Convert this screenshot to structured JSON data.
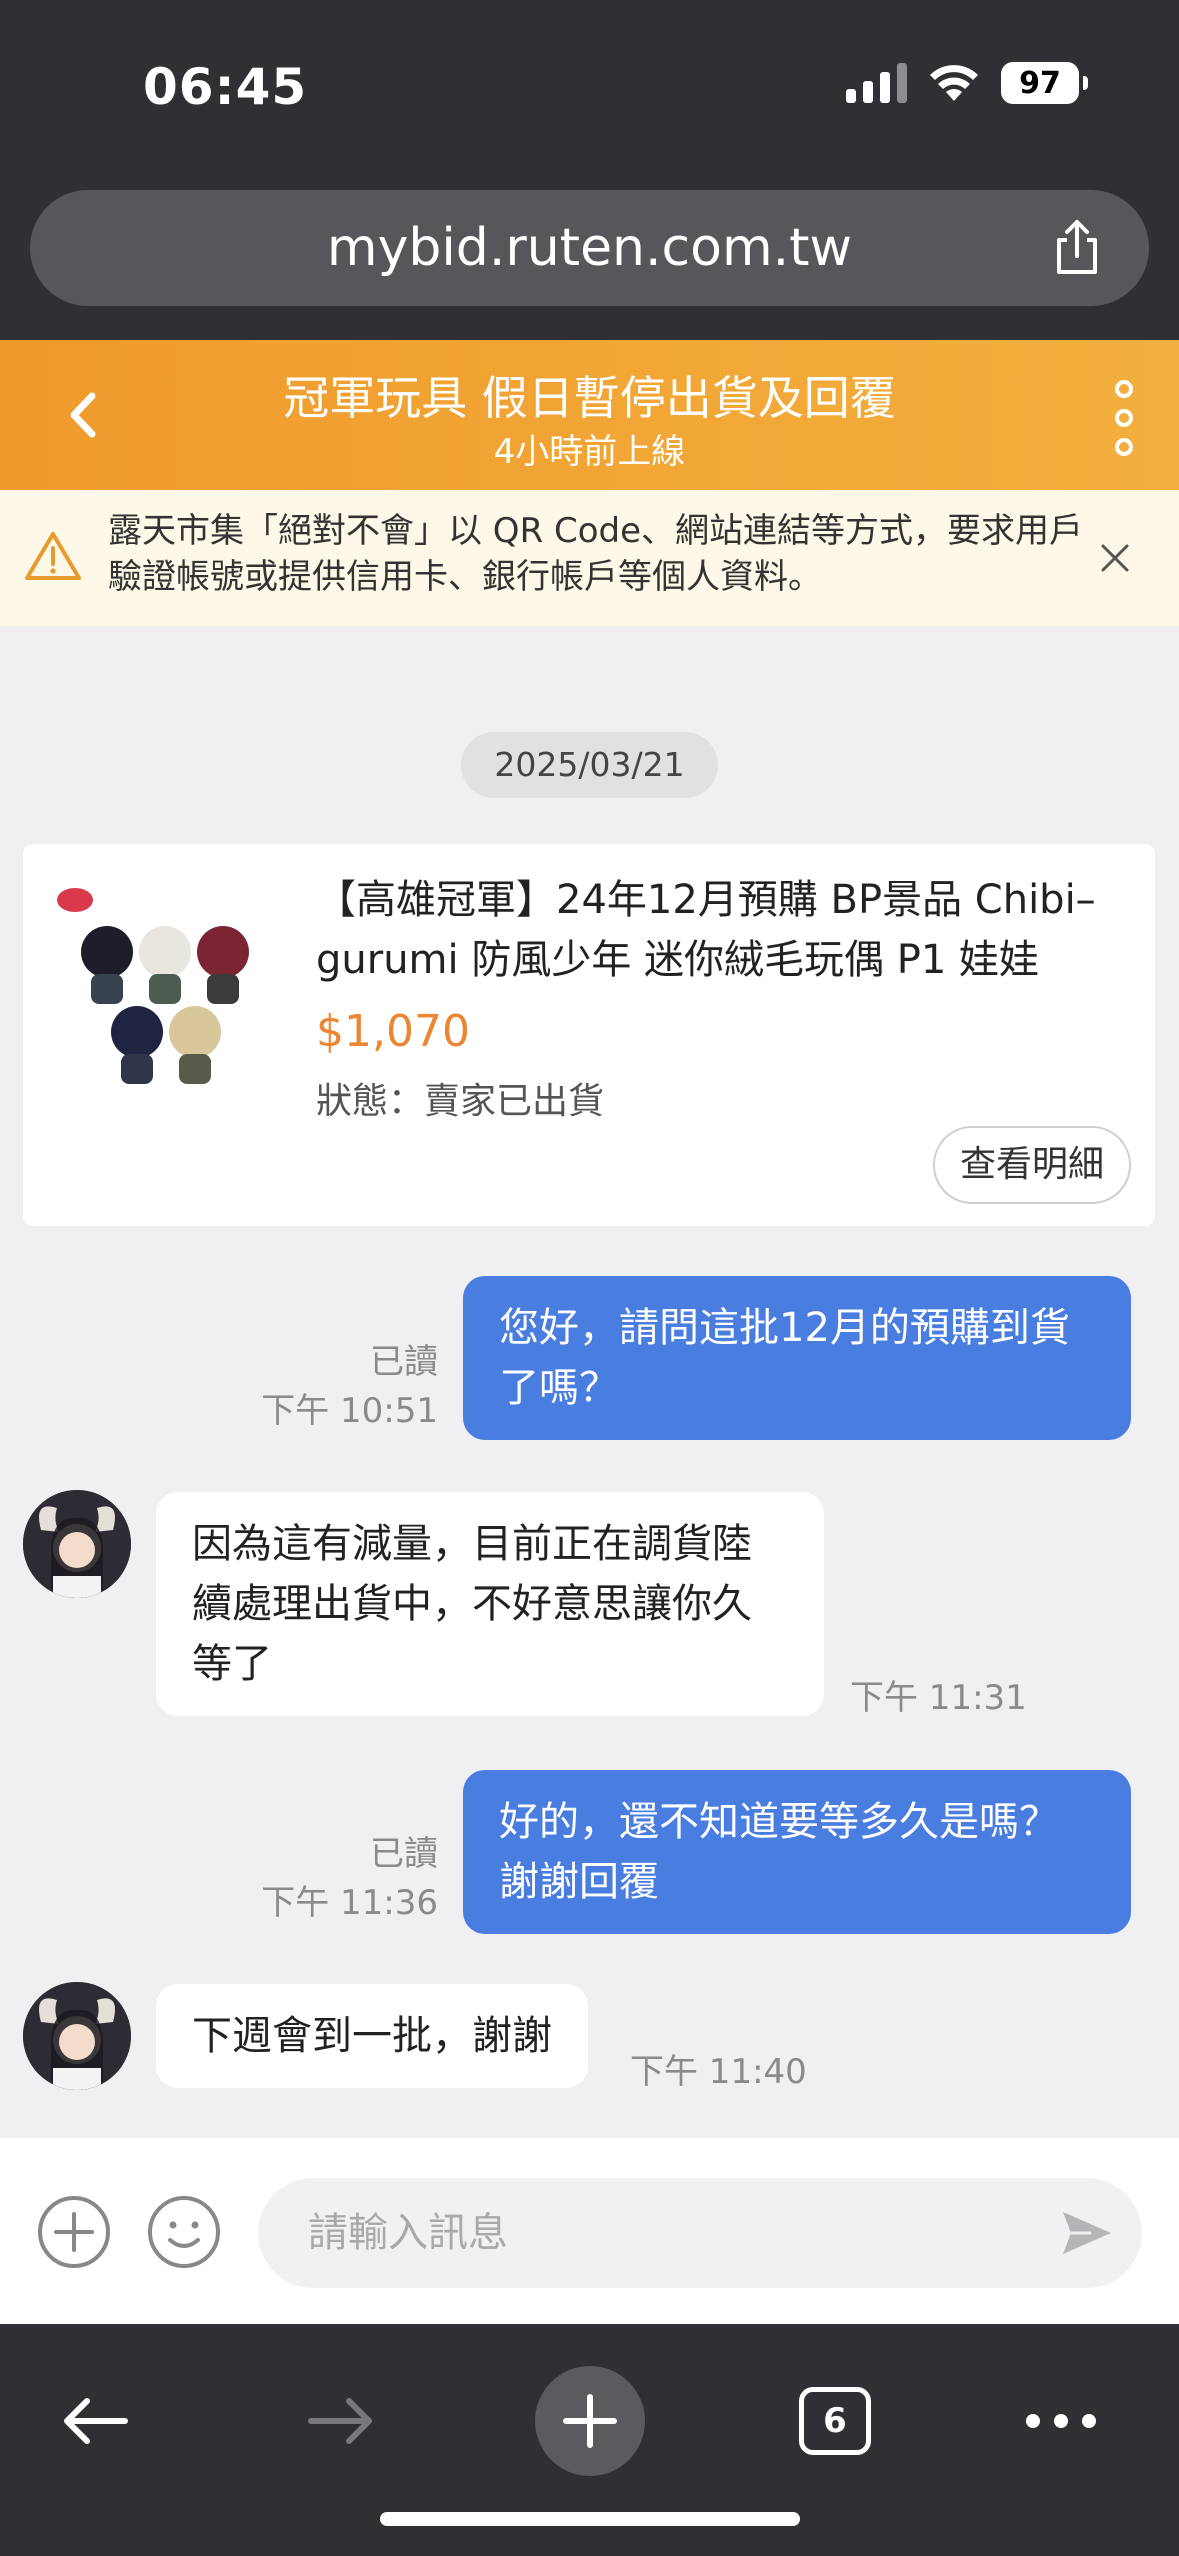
{
  "status_bar": {
    "time": "06:45",
    "battery": "97"
  },
  "browser": {
    "url": "mybid.ruten.com.tw",
    "tab_count": "6"
  },
  "header": {
    "title": "冠軍玩具 假日暫停出貨及回覆",
    "subtitle": "4小時前上線"
  },
  "warning": {
    "text": "露天市集「絕對不會」以 QR Code、網站連結等方式，要求用戶驗證帳號或提供信用卡、銀行帳戶等個人資料。"
  },
  "chat": {
    "date": "2025/03/21",
    "product": {
      "title": "【高雄冠軍】24年12月預購 BP景品 Chibi–gurumi 防風少年 迷你絨毛玩偶 P1 娃娃",
      "price": "$1,070",
      "status": "狀態：賣家已出貨",
      "detail_button": "查看明細"
    },
    "messages": [
      {
        "dir": "out",
        "text": "您好，請問這批12月的預購到貨了嗎？",
        "read": "已讀",
        "time": "下午 10:51"
      },
      {
        "dir": "in",
        "text": "因為這有減量，目前正在調貨陸續處理出貨中，不好意思讓你久等了",
        "time": "下午 11:31"
      },
      {
        "dir": "out",
        "text": "好的，還不知道要等多久是嗎？謝謝回覆",
        "read": "已讀",
        "time": "下午 11:36"
      },
      {
        "dir": "in",
        "text": "下週會到一批，謝謝",
        "time": "下午 11:40"
      }
    ]
  },
  "input": {
    "placeholder": "請輸入訊息"
  },
  "colors": {
    "header_orange": "#f0a033",
    "outgoing_bubble": "#4a7de0",
    "price_orange": "#ec8632"
  }
}
